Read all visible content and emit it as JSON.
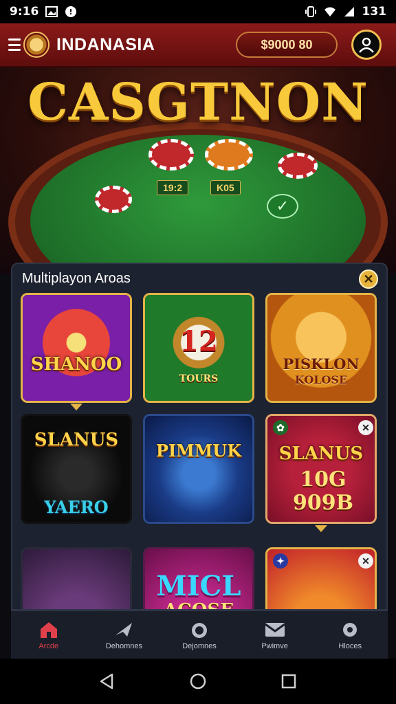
{
  "status_bar": {
    "time": "9:16",
    "battery": "131"
  },
  "app_bar": {
    "brand": "INDANASIA",
    "balance": "$9000 80"
  },
  "hero": {
    "title": "CASGTNON",
    "felt_label_left": "19:2",
    "felt_label_right": "K05"
  },
  "panel": {
    "title": "Multiplayon Aroas",
    "cards": [
      {
        "title": "SHANOO",
        "sub": ""
      },
      {
        "title": "12",
        "sub": "TOURS"
      },
      {
        "title": "PISKLON",
        "sub": "KOLOSE"
      },
      {
        "title": "SLANUS",
        "sub": "YAERO"
      },
      {
        "title": "PIMMUK",
        "sub": ""
      },
      {
        "title": "SLANUS",
        "sub": "10G 909B"
      },
      {
        "title": "",
        "sub": ""
      },
      {
        "title": "MICL",
        "sub": "ACOSE"
      },
      {
        "title": "",
        "sub": ""
      }
    ]
  },
  "bottom_nav": [
    {
      "label": "Arcde",
      "icon": "home-icon",
      "active": true
    },
    {
      "label": "Dehomnes",
      "icon": "plane-icon",
      "active": false
    },
    {
      "label": "Dejomnes",
      "icon": "bomb-icon",
      "active": false
    },
    {
      "label": "Pwimve",
      "icon": "mail-icon",
      "active": false
    },
    {
      "label": "Hloces",
      "icon": "gear-icon",
      "active": false
    }
  ],
  "colors": {
    "accent_red": "#8c1a1a",
    "gold": "#e4b448",
    "panel_bg": "#1d2230",
    "felt": "#2f9a3b"
  }
}
